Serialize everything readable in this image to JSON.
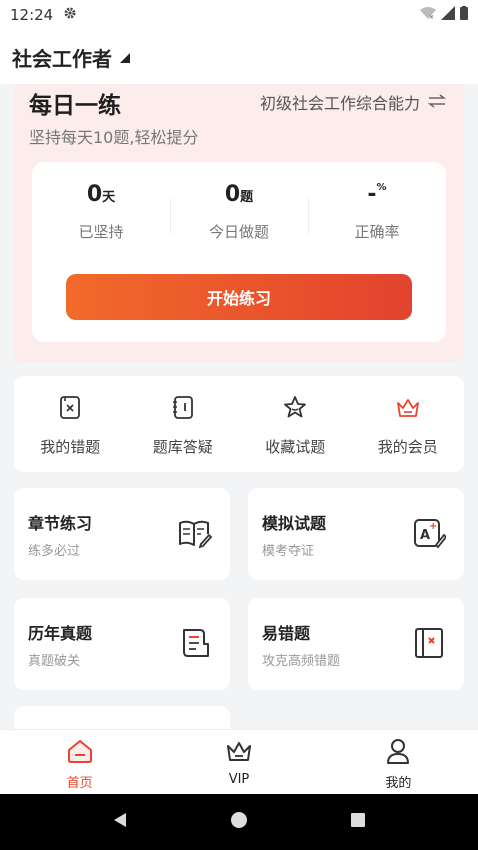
{
  "status": {
    "time": "12:24"
  },
  "header": {
    "title": "社会工作者"
  },
  "daily": {
    "title": "每日一练",
    "subtitle": "坚持每天10题,轻松提分",
    "exam": "初级社会工作综合能力",
    "stats": [
      {
        "value": "0",
        "unit": "天",
        "label": "已坚持"
      },
      {
        "value": "0",
        "unit": "题",
        "label": "今日做题"
      },
      {
        "value": "-",
        "unit": "%",
        "label": "正确率"
      }
    ],
    "start_label": "开始练习"
  },
  "quick": [
    {
      "label": "我的错题",
      "icon": "wrong-book-icon"
    },
    {
      "label": "题库答疑",
      "icon": "qa-book-icon"
    },
    {
      "label": "收藏试题",
      "icon": "star-icon"
    },
    {
      "label": "我的会员",
      "icon": "crown-icon"
    }
  ],
  "cards": [
    {
      "title": "章节练习",
      "desc": "练多必过",
      "icon": "open-book-edit-icon"
    },
    {
      "title": "模拟试题",
      "desc": "模考夺证",
      "icon": "grade-edit-icon"
    },
    {
      "title": "历年真题",
      "desc": "真题破关",
      "icon": "document-icon"
    },
    {
      "title": "易错题",
      "desc": "攻克高频错题",
      "icon": "error-panel-icon"
    }
  ],
  "tabs": [
    {
      "label": "首页",
      "icon": "home-icon",
      "active": true
    },
    {
      "label": "VIP",
      "icon": "crown-icon"
    },
    {
      "label": "我的",
      "icon": "user-icon"
    }
  ],
  "colors": {
    "accent": "#e8452e",
    "gradient_start": "#f26a2a",
    "banner_bg": "#fcecec"
  }
}
